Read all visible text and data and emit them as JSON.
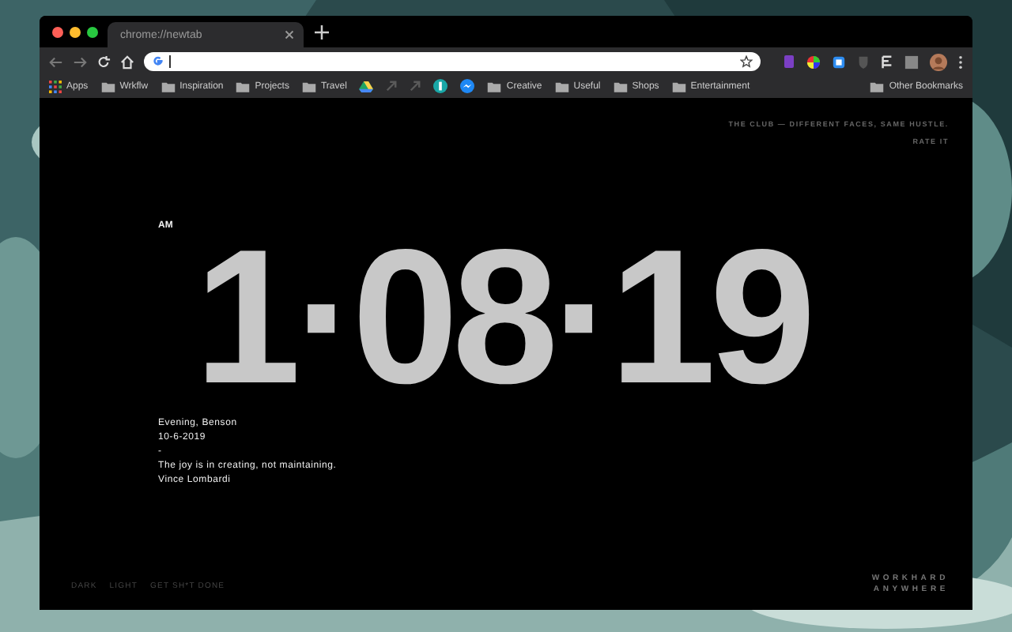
{
  "tabs": [
    {
      "label": "chrome://newtab",
      "selected": true
    }
  ],
  "bookmarks": [
    {
      "kind": "apps",
      "label": "Apps"
    },
    {
      "kind": "folder",
      "label": "Wrkflw"
    },
    {
      "kind": "folder",
      "label": "Inspiration"
    },
    {
      "kind": "folder",
      "label": "Projects"
    },
    {
      "kind": "folder",
      "label": "Travel"
    },
    {
      "kind": "drive"
    },
    {
      "kind": "dim"
    },
    {
      "kind": "dim"
    },
    {
      "kind": "teal"
    },
    {
      "kind": "chat"
    },
    {
      "kind": "folder",
      "label": "Creative"
    },
    {
      "kind": "folder",
      "label": "Useful"
    },
    {
      "kind": "folder",
      "label": "Shops"
    },
    {
      "kind": "folder",
      "label": "Entertainment"
    }
  ],
  "other_bookmarks": {
    "label": "Other Bookmarks"
  },
  "page": {
    "tagline": "THE CLUB — DIFFERENT FACES, SAME HUSTLE.",
    "rate_link": "RATE IT",
    "meridiem": "AM",
    "time": "1·08·19",
    "greeting": "Evening, Benson",
    "date": "10-6-2019",
    "separator": "-",
    "quote": "The joy is in creating, not maintaining.",
    "author": "Vince Lombardi",
    "themes": [
      {
        "label": "DARK"
      },
      {
        "label": "LIGHT"
      },
      {
        "label": "GET SH*T DONE"
      }
    ],
    "brand": [
      "WORKHARD",
      "ANYWHERE"
    ]
  }
}
